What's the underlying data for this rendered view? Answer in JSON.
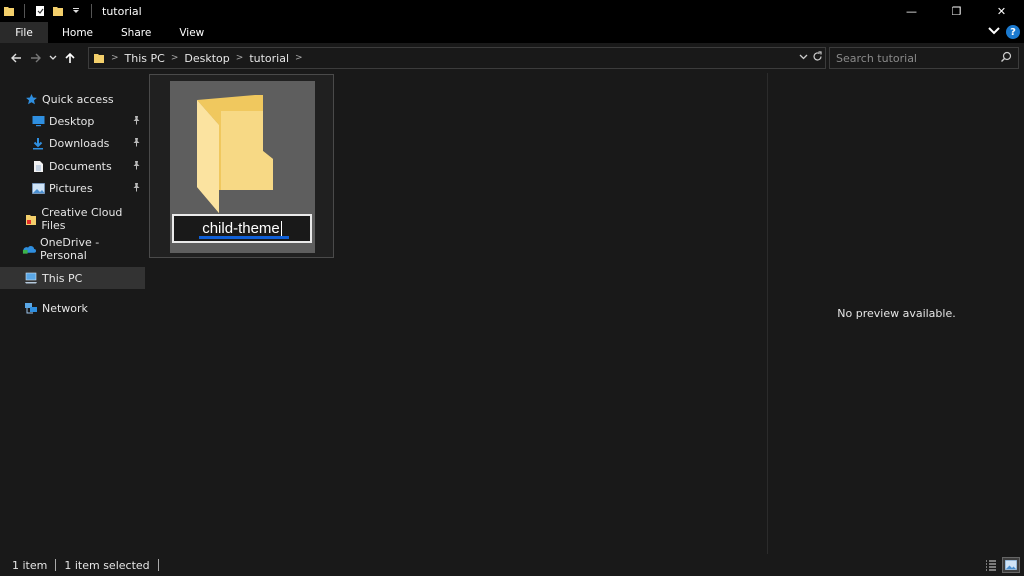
{
  "window": {
    "title": "tutorial",
    "controls": {
      "minimize": "—",
      "maximize": "❐",
      "close": "✕"
    }
  },
  "ribbon": {
    "tabs": [
      {
        "label": "File"
      },
      {
        "label": "Home"
      },
      {
        "label": "Share"
      },
      {
        "label": "View"
      }
    ],
    "help_label": "?"
  },
  "address": {
    "crumbs": [
      "This PC",
      "Desktop",
      "tutorial"
    ],
    "search_placeholder": "Search tutorial"
  },
  "navpane": {
    "items": [
      {
        "label": "Quick access",
        "icon": "star-icon"
      },
      {
        "label": "Desktop",
        "icon": "desktop-icon",
        "pinned": true
      },
      {
        "label": "Downloads",
        "icon": "download-icon",
        "pinned": true
      },
      {
        "label": "Documents",
        "icon": "documents-icon",
        "pinned": true
      },
      {
        "label": "Pictures",
        "icon": "pictures-icon",
        "pinned": true
      },
      {
        "label": "Creative Cloud Files",
        "icon": "creative-cloud-icon"
      },
      {
        "label": "OneDrive - Personal",
        "icon": "onedrive-icon"
      },
      {
        "label": "This PC",
        "icon": "computer-icon",
        "selected": true
      },
      {
        "label": "Network",
        "icon": "network-icon"
      }
    ]
  },
  "content": {
    "folder": {
      "name": "child-theme",
      "state": "renaming"
    }
  },
  "preview": {
    "message": "No preview available."
  },
  "status": {
    "item_count": "1 item",
    "selected_count": "1 item selected"
  },
  "colors": {
    "folder_yellow": "#f3cf6b",
    "accent_blue": "#1060d8",
    "help_blue": "#1b7ad0",
    "selection_gray": "#5e5e5e"
  }
}
